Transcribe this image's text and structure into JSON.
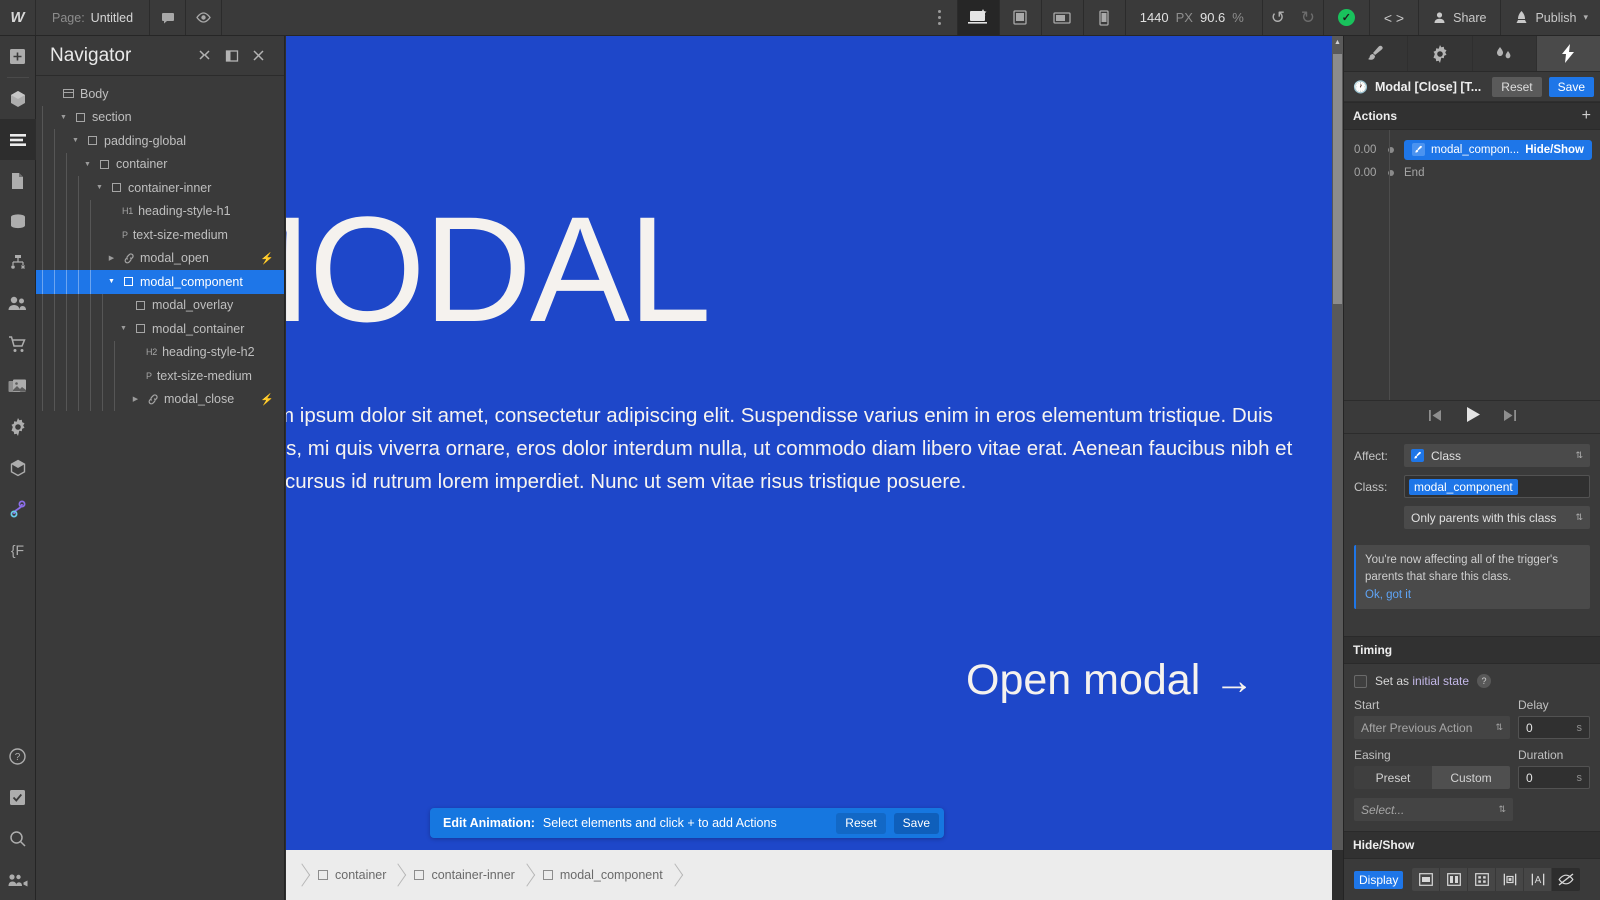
{
  "topbar": {
    "logo": "W",
    "page_label": "Page:",
    "page_value": "Untitled",
    "comment_icon": "comment-icon",
    "preview_icon": "eye-icon",
    "more_icon": "more-vertical-icon",
    "devices": [
      {
        "name": "desktop",
        "icon": "desktop-icon",
        "active": true
      },
      {
        "name": "tablet",
        "icon": "tablet-icon",
        "active": false
      },
      {
        "name": "landscape",
        "icon": "tablet-landscape-icon",
        "active": false
      },
      {
        "name": "mobile",
        "icon": "mobile-icon",
        "active": false
      }
    ],
    "width_value": "1440",
    "width_unit": "PX",
    "zoom_value": "90.6",
    "zoom_unit": "%",
    "undo_icon": "undo-icon",
    "redo_icon": "redo-icon",
    "status_icon": "check-circle-icon",
    "code_icon": "code-brackets-icon",
    "share_label": "Share",
    "publish_label": "Publish"
  },
  "rail": {
    "items": [
      {
        "name": "add-panel",
        "icon": "plus-icon"
      },
      {
        "name": "components",
        "icon": "cube-icon"
      },
      {
        "name": "navigator",
        "icon": "layers-icon",
        "selected": true
      },
      {
        "name": "pages",
        "icon": "page-icon"
      },
      {
        "name": "cms",
        "icon": "database-icon"
      },
      {
        "name": "logic",
        "icon": "logic-icon"
      },
      {
        "name": "users",
        "icon": "users-icon"
      },
      {
        "name": "ecommerce",
        "icon": "cart-icon"
      },
      {
        "name": "assets",
        "icon": "assets-icon"
      },
      {
        "name": "settings",
        "icon": "gear-icon"
      },
      {
        "name": "symbols",
        "icon": "cube-outline-icon"
      },
      {
        "name": "interactions",
        "icon": "interactions-icon"
      },
      {
        "name": "variables",
        "icon": "variables-icon"
      }
    ],
    "bottom_items": [
      {
        "name": "help",
        "icon": "question-circle-icon"
      },
      {
        "name": "audit",
        "icon": "checkbox-icon"
      },
      {
        "name": "search",
        "icon": "search-icon"
      },
      {
        "name": "video",
        "icon": "video-users-icon"
      }
    ]
  },
  "navigator": {
    "title": "Navigator",
    "header_buttons": [
      {
        "name": "collapse-all-button",
        "icon": "collapse-icon"
      },
      {
        "name": "dock-panel-button",
        "icon": "panel-icon"
      },
      {
        "name": "close-panel-button",
        "icon": "close-icon"
      }
    ],
    "tree": [
      {
        "label": "Body",
        "depth": 0,
        "tag": "",
        "icon": "body-icon",
        "arrow": "none",
        "selected": false,
        "bolt": false
      },
      {
        "label": "section",
        "depth": 1,
        "tag": "",
        "icon": "box-icon",
        "arrow": "down",
        "selected": false,
        "bolt": false
      },
      {
        "label": "padding-global",
        "depth": 2,
        "tag": "",
        "icon": "box-icon",
        "arrow": "down",
        "selected": false,
        "bolt": false
      },
      {
        "label": "container",
        "depth": 3,
        "tag": "",
        "icon": "box-icon",
        "arrow": "down",
        "selected": false,
        "bolt": false
      },
      {
        "label": "container-inner",
        "depth": 4,
        "tag": "",
        "icon": "box-icon",
        "arrow": "down",
        "selected": false,
        "bolt": false
      },
      {
        "label": "heading-style-h1",
        "depth": 5,
        "tag": "H1",
        "icon": "tag-icon",
        "arrow": "none",
        "selected": false,
        "bolt": false
      },
      {
        "label": "text-size-medium",
        "depth": 5,
        "tag": "P",
        "icon": "tag-icon",
        "arrow": "none",
        "selected": false,
        "bolt": false
      },
      {
        "label": "modal_open",
        "depth": 5,
        "tag": "",
        "icon": "link-icon",
        "arrow": "right",
        "selected": false,
        "bolt": true
      },
      {
        "label": "modal_component",
        "depth": 5,
        "tag": "",
        "icon": "box-icon",
        "arrow": "down",
        "selected": true,
        "bolt": false
      },
      {
        "label": "modal_overlay",
        "depth": 6,
        "tag": "",
        "icon": "box-icon",
        "arrow": "none",
        "selected": false,
        "bolt": false
      },
      {
        "label": "modal_container",
        "depth": 6,
        "tag": "",
        "icon": "box-icon",
        "arrow": "down",
        "selected": false,
        "bolt": false
      },
      {
        "label": "heading-style-h2",
        "depth": 7,
        "tag": "H2",
        "icon": "tag-icon",
        "arrow": "none",
        "selected": false,
        "bolt": false
      },
      {
        "label": "text-size-medium",
        "depth": 7,
        "tag": "P",
        "icon": "tag-icon",
        "arrow": "none",
        "selected": false,
        "bolt": false
      },
      {
        "label": "modal_close",
        "depth": 7,
        "tag": "",
        "icon": "link-icon",
        "arrow": "right",
        "selected": false,
        "bolt": true
      }
    ]
  },
  "canvas": {
    "background_color": "#1e47c9",
    "heading": "MODAL",
    "paragraph": "Lorem ipsum dolor sit amet, consectetur adipiscing elit. Suspendisse varius enim in eros elementum tristique. Duis cursus, mi quis viverra ornare, eros dolor interdum nulla, ut commodo diam libero vitae erat. Aenean faucibus nibh et justo cursus id rutrum lorem imperdiet. Nunc ut sem vitae risus tristique posuere.",
    "link_label": "Open modal",
    "link_arrow": "→"
  },
  "notification": {
    "strong": "Edit Animation:",
    "message": "Select elements and click + to add Actions",
    "reset_label": "Reset",
    "save_label": "Save"
  },
  "breadcrumb": {
    "items": [
      "container",
      "container-inner",
      "modal_component"
    ]
  },
  "right_panel": {
    "tabs": [
      {
        "name": "style-tab",
        "icon": "brush-icon",
        "active": false
      },
      {
        "name": "settings-tab",
        "icon": "gear-icon",
        "active": false
      },
      {
        "name": "style-manager-tab",
        "icon": "drops-icon",
        "active": false
      },
      {
        "name": "interactions-tab",
        "icon": "bolt-icon",
        "active": true
      }
    ],
    "header": {
      "icon": "clock-icon",
      "title": "Modal [Close] [T...",
      "reset_label": "Reset",
      "save_label": "Save"
    },
    "actions": {
      "section_title": "Actions",
      "add_icon": "plus-icon",
      "rows": [
        {
          "time": "0.00",
          "label": "modal_compon...",
          "type": "Hide/Show",
          "pill": true
        },
        {
          "time": "0.00",
          "label": "End",
          "type": "",
          "pill": false
        }
      ]
    },
    "player": {
      "prev_icon": "skip-start-icon",
      "play_icon": "play-icon",
      "next_icon": "skip-end-icon"
    },
    "affect": {
      "label": "Affect:",
      "value": "Class",
      "icon": "brush-icon"
    },
    "class": {
      "label": "Class:",
      "value": "modal_component",
      "scope": "Only parents with this class"
    },
    "callout": {
      "text": "You're now affecting all of the trigger's parents that share this class.",
      "link": "Ok, got it"
    },
    "timing": {
      "section_title": "Timing",
      "initial_state_label_a": "Set as ",
      "initial_state_label_b": "initial state",
      "help_icon": "question-icon",
      "start_label": "Start",
      "start_value": "After Previous Action",
      "delay_label": "Delay",
      "delay_value": "0",
      "delay_unit": "s",
      "easing_label": "Easing",
      "easing_preset": "Preset",
      "easing_custom": "Custom",
      "easing_select": "Select...",
      "duration_label": "Duration",
      "duration_value": "0",
      "duration_unit": "s"
    },
    "hide_show": {
      "section_title": "Hide/Show",
      "display_label": "Display",
      "options": [
        {
          "name": "display-block",
          "icon": "block-icon",
          "active": false
        },
        {
          "name": "display-flex",
          "icon": "flex-icon",
          "active": false
        },
        {
          "name": "display-grid",
          "icon": "grid-icon",
          "active": false
        },
        {
          "name": "display-inline-block",
          "icon": "inline-block-icon",
          "active": false
        },
        {
          "name": "display-inline",
          "icon": "inline-icon",
          "active": false
        },
        {
          "name": "display-none",
          "icon": "none-icon",
          "active": true
        }
      ]
    }
  }
}
